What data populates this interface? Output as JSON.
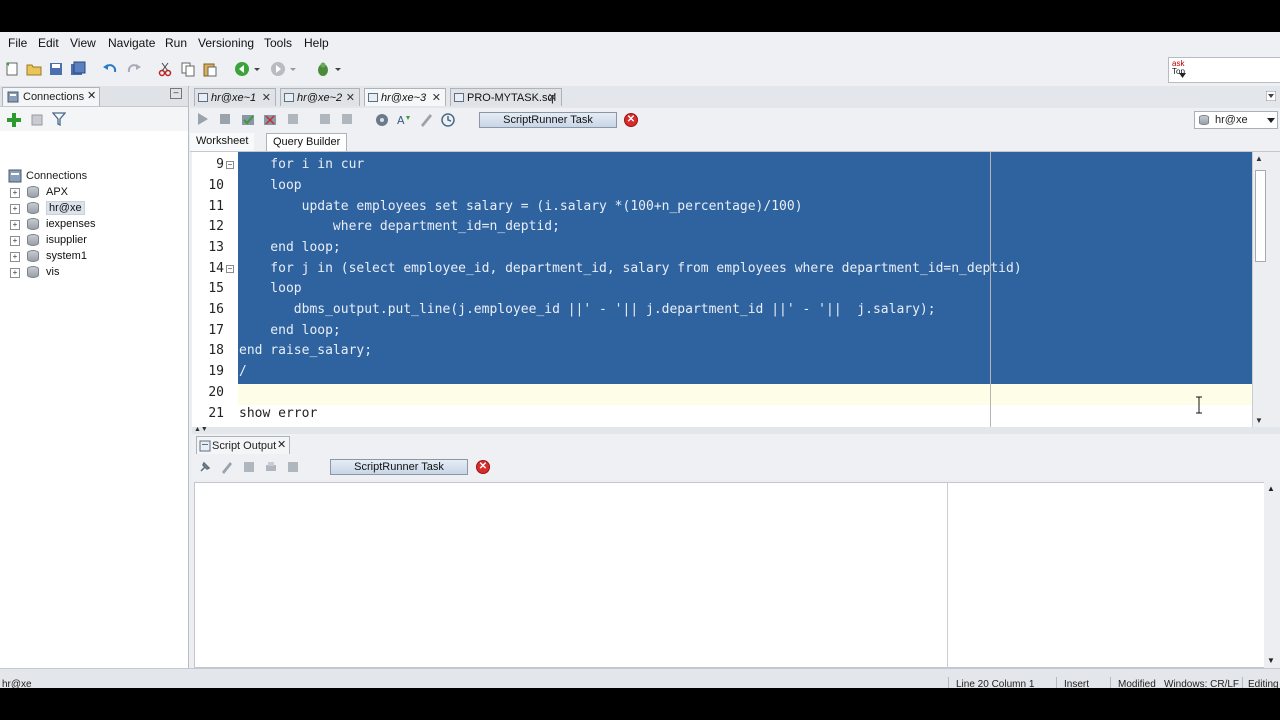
{
  "menu": [
    "File",
    "Edit",
    "View",
    "Navigate",
    "Run",
    "Versioning",
    "Tools",
    "Help"
  ],
  "search": {
    "line1": "ask",
    "line2": "Top"
  },
  "connections_panel": {
    "tab_label": "Connections",
    "root_label": "Connections",
    "items": [
      "APX",
      "hr@xe",
      "iexpenses",
      "isupplier",
      "system1",
      "vis"
    ],
    "selected": "hr@xe"
  },
  "doc_tabs": [
    {
      "label": "hr@xe~1"
    },
    {
      "label": "hr@xe~2"
    },
    {
      "label": "hr@xe~3",
      "active": true
    },
    {
      "label": "PRO-MYTASK.sql"
    }
  ],
  "editor_toolbar": {
    "task_label": "ScriptRunner Task",
    "connection": "hr@xe"
  },
  "sub_tabs": {
    "worksheet": "Worksheet",
    "query_builder": "Query Builder"
  },
  "code_lines": [
    {
      "n": "9",
      "text": "    for i in cur",
      "fold": true
    },
    {
      "n": "10",
      "text": "    loop"
    },
    {
      "n": "11",
      "text": "        update employees set salary = (i.salary *(100+n_percentage)/100)"
    },
    {
      "n": "12",
      "text": "            where department_id=n_deptid;"
    },
    {
      "n": "13",
      "text": "    end loop;"
    },
    {
      "n": "14",
      "text": "    for j in (select employee_id, department_id, salary from employees where department_id=n_deptid)",
      "fold": true
    },
    {
      "n": "15",
      "text": "    loop"
    },
    {
      "n": "16",
      "text": "       dbms_output.put_line(j.employee_id ||' - '|| j.department_id ||' - '||  j.salary);"
    },
    {
      "n": "17",
      "text": "    end loop;"
    },
    {
      "n": "18",
      "text": "end raise_salary;"
    },
    {
      "n": "19",
      "text": "/"
    },
    {
      "n": "20",
      "text": ""
    },
    {
      "n": "21",
      "text": "show error"
    }
  ],
  "output": {
    "tab_label": "Script Output",
    "task_label": "ScriptRunner Task"
  },
  "status": {
    "connection": "hr@xe",
    "position": "Line 20 Column 1",
    "mode": "Insert",
    "modified": "Modified",
    "line_ending": "Windows: CR/LF",
    "editing": "Editing"
  }
}
